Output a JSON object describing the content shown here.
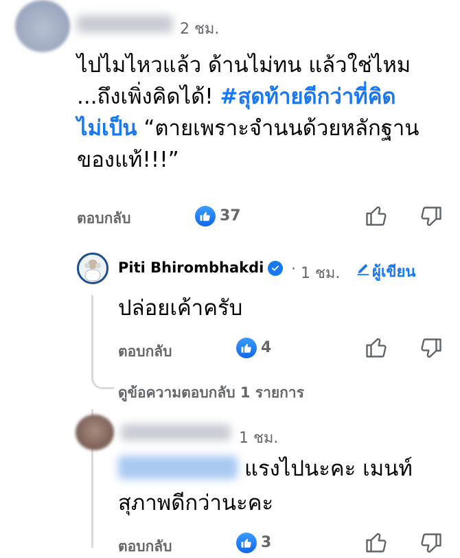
{
  "comment1": {
    "time": "2 ชม.",
    "text_parts": {
      "line1": "ไปไมไหวแล้ว ด้านไม่ทน แล้วใช่ไหม",
      "line2_prefix": "...ถึงเพิ่งคิดได้!  ",
      "hashtag_line2": "#สุดท้ายดีกว่าที่คิด",
      "hashtag_line3": "ไม่เป็น",
      "line3_suffix": " “ตายเพราะจำนนด้วยหลักฐาน",
      "line4": "ของแท้!!!”"
    },
    "reply_label": "ตอบกลับ",
    "like_count": "37"
  },
  "reply1": {
    "author": "Piti Bhirombhakdi",
    "verified_icon": "verified-check-icon",
    "separator": "·",
    "time": "1 ชม.",
    "author_badge": "ผู้เขียน",
    "text": "ปล่อยเค้าครับ",
    "reply_label": "ตอบกลับ",
    "like_count": "4",
    "view_replies": "ดูข้อความตอบกลับ 1 รายการ"
  },
  "reply2": {
    "time": "1 ชม.",
    "line1": "แรงไปนะคะ  เมนท์",
    "line2": "สุภาพดีกว่านะคะ",
    "reply_label": "ตอบกลับ",
    "like_count": "3"
  },
  "colors": {
    "accent": "#1877f2",
    "muted": "#65676b",
    "text": "#050505"
  }
}
